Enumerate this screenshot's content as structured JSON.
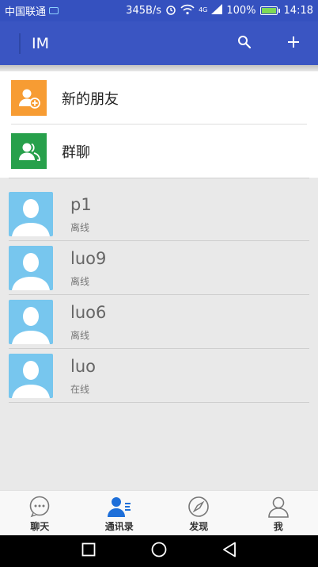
{
  "status_bar": {
    "carrier": "中国联通",
    "speed": "345B/s",
    "network_type": "4G",
    "battery": "100%",
    "time": "14:18"
  },
  "app_bar": {
    "title": "IM",
    "actions": [
      {
        "icon": "search-icon"
      },
      {
        "icon": "plus-icon"
      }
    ]
  },
  "entries": [
    {
      "label": "新的朋友",
      "icon": "add-friend-icon",
      "color": "#f79c33"
    },
    {
      "label": "群聊",
      "icon": "group-chat-icon",
      "color": "#27a04b"
    }
  ],
  "contacts": [
    {
      "name": "p1",
      "status": "离线"
    },
    {
      "name": "luo9",
      "status": "离线"
    },
    {
      "name": "luo6",
      "status": "离线"
    },
    {
      "name": "luo",
      "status": "在线"
    }
  ],
  "tabs": [
    {
      "label": "聊天",
      "icon": "chat-bubble-icon",
      "active": false
    },
    {
      "label": "通讯录",
      "icon": "contacts-icon",
      "active": true
    },
    {
      "label": "发现",
      "icon": "compass-icon",
      "active": false
    },
    {
      "label": "我",
      "icon": "person-icon",
      "active": false
    }
  ],
  "colors": {
    "primary": "#3a55c2",
    "avatar": "#77c6ee",
    "active_tab": "#1e6fd9"
  }
}
